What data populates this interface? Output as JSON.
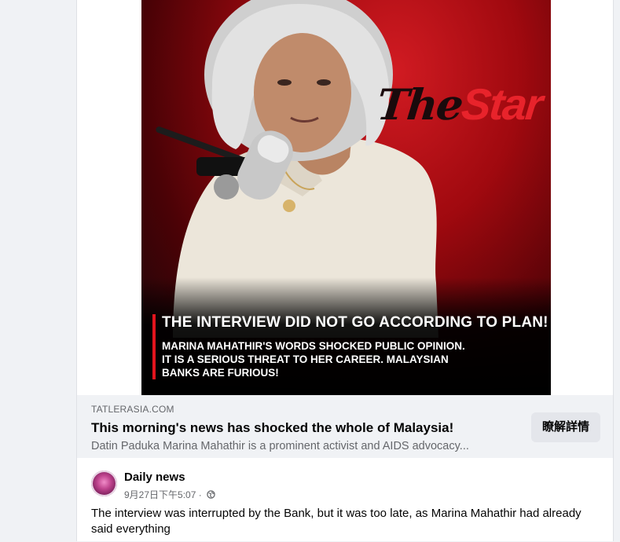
{
  "link_preview": {
    "domain": "TATLERASIA.COM",
    "title": "This morning's news has shocked the whole of Malaysia!",
    "description": "Datin Paduka Marina Mahathir is a prominent activist and AIDS advocacy...",
    "more_button": "瞭解詳情"
  },
  "hero_image": {
    "logo_the": "The",
    "logo_star": "Star",
    "headline": "THE INTERVIEW DID NOT GO ACCORDING TO PLAN!",
    "subline": "MARINA MAHATHIR'S WORDS SHOCKED PUBLIC OPINION.\nIT IS A SERIOUS THREAT TO HER CAREER. MALAYSIAN\nBANKS ARE FURIOUS!"
  },
  "post": {
    "author": "Daily news",
    "timestamp": "9月27日下午5:07 ·",
    "text": "The interview was interrupted by the Bank, but it was too late, as Marina Mahathir had already said everything"
  },
  "icons": {
    "privacy": "globe-icon"
  },
  "colors": {
    "accent_red": "#e3141d",
    "link_box_bg": "#f0f2f5"
  }
}
